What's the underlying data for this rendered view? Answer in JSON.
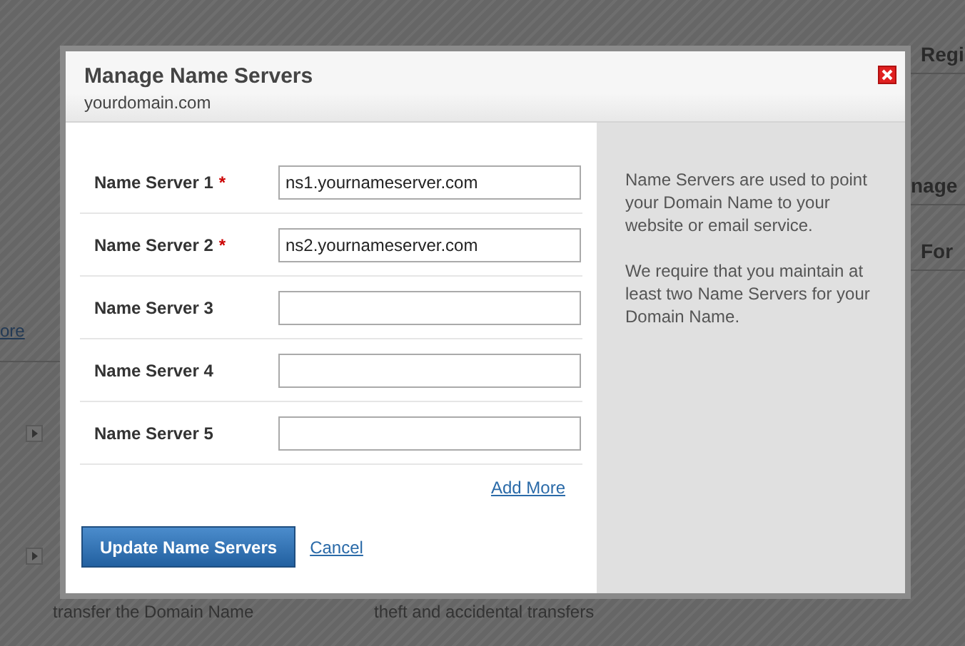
{
  "background": {
    "side_items": [
      {
        "text": "Regi"
      },
      {
        "text": "nage"
      },
      {
        "text": "For"
      }
    ],
    "link": "ore",
    "list_items": [
      {
        "kind": "row"
      },
      {
        "kind": "row"
      }
    ],
    "captions": [
      "transfer the Domain Name",
      "theft and accidental transfers"
    ]
  },
  "dialog": {
    "title": "Manage Name Servers",
    "subtitle": "yourdomain.com",
    "fields": [
      {
        "label": "Name Server 1",
        "mark": "*",
        "value": "ns1.yournameserver.com"
      },
      {
        "label": "Name Server 2",
        "mark": "*",
        "value": "ns2.yournameserver.com"
      },
      {
        "label": "Name Server 3"
      },
      {
        "label": "Name Server 4"
      },
      {
        "label": "Name Server 5"
      }
    ],
    "add_more": "Add More",
    "submit": "Update Name Servers",
    "cancel": "Cancel",
    "help": [
      "Name Servers are used to point your Domain Name to your website or email service.",
      "We require that you maintain at least two Name Servers for your Domain Name."
    ]
  }
}
